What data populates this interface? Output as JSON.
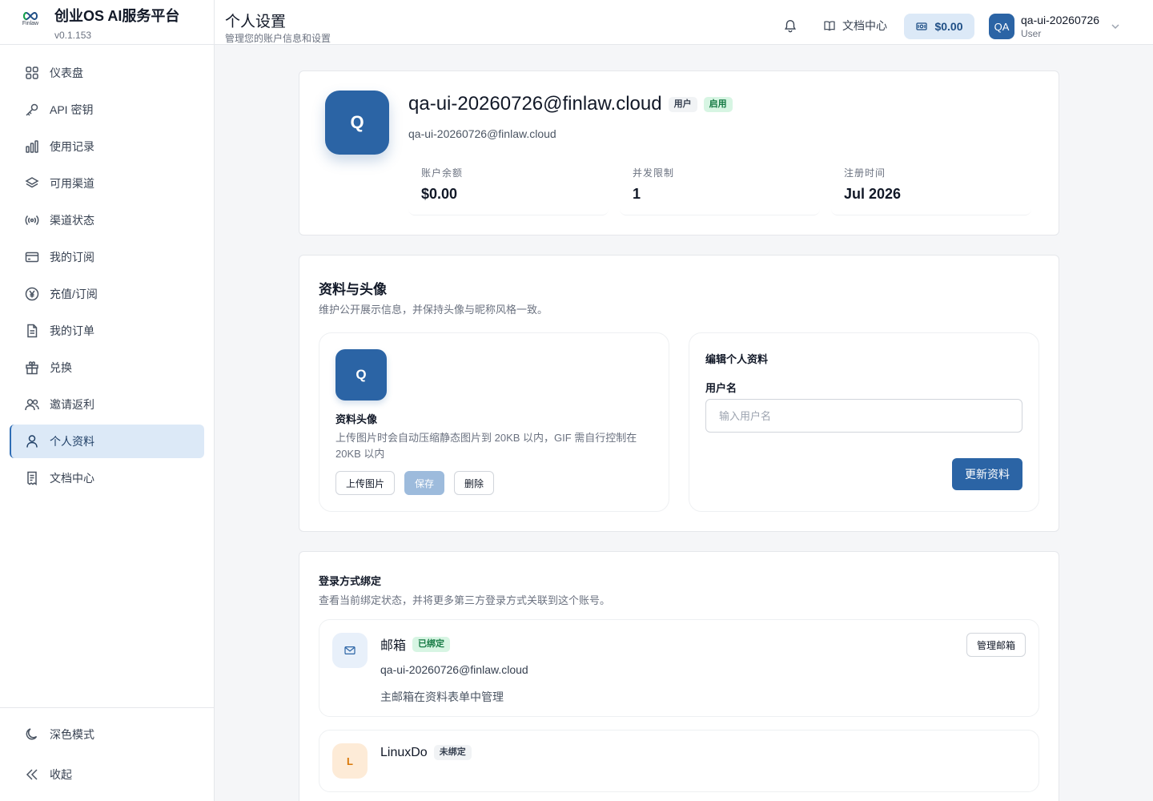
{
  "brand": {
    "title": "创业OS AI服务平台",
    "version": "v0.1.153",
    "logo_text": "Finlaw"
  },
  "sidebar": {
    "items": [
      {
        "label": "仪表盘",
        "icon": "dashboard-icon"
      },
      {
        "label": "API 密钥",
        "icon": "key-icon"
      },
      {
        "label": "使用记录",
        "icon": "bar-chart-icon"
      },
      {
        "label": "可用渠道",
        "icon": "layers-icon"
      },
      {
        "label": "渠道状态",
        "icon": "signal-icon"
      },
      {
        "label": "我的订阅",
        "icon": "credit-card-icon"
      },
      {
        "label": "充值/订阅",
        "icon": "yen-coin-icon"
      },
      {
        "label": "我的订单",
        "icon": "document-icon"
      },
      {
        "label": "兑换",
        "icon": "gift-icon"
      },
      {
        "label": "邀请返利",
        "icon": "users-icon"
      },
      {
        "label": "个人资料",
        "icon": "user-icon",
        "active": true
      },
      {
        "label": "文档中心",
        "icon": "receipt-icon"
      }
    ],
    "bottom": [
      {
        "label": "深色模式",
        "icon": "moon-icon"
      },
      {
        "label": "收起",
        "icon": "double-chevron-left-icon"
      }
    ]
  },
  "header": {
    "title": "个人设置",
    "subtitle": "管理您的账户信息和设置",
    "docs_label": "文档中心",
    "balance": "$0.00",
    "user_initials": "QA",
    "user_name": "qa-ui-20260726",
    "user_role": "User"
  },
  "profile": {
    "initial": "Q",
    "name": "qa-ui-20260726@finlaw.cloud",
    "role_tag": "用户",
    "status_tag": "启用",
    "email": "qa-ui-20260726@finlaw.cloud",
    "stats": [
      {
        "label": "账户余额",
        "value": "$0.00"
      },
      {
        "label": "并发限制",
        "value": "1"
      },
      {
        "label": "注册时间",
        "value": "Jul 2026"
      }
    ]
  },
  "profile_section": {
    "title": "资料与头像",
    "description": "维护公开展示信息，并保持头像与昵称风格一致。",
    "avatar_initial": "Q",
    "avatar_label": "资料头像",
    "avatar_hint": "上传图片时会自动压缩静态图片到 20KB 以内，GIF 需自行控制在 20KB 以内",
    "upload_label": "上传图片",
    "save_label": "保存",
    "delete_label": "删除",
    "edit_title": "编辑个人资料",
    "username_label": "用户名",
    "username_placeholder": "输入用户名",
    "username_value": "",
    "update_label": "更新资料"
  },
  "bindings": {
    "title": "登录方式绑定",
    "description": "查看当前绑定状态，并将更多第三方登录方式关联到这个账号。",
    "email": {
      "name": "邮箱",
      "status": "已绑定",
      "value": "qa-ui-20260726@finlaw.cloud",
      "note": "主邮箱在资料表单中管理",
      "manage_label": "管理邮箱"
    },
    "linuxdo": {
      "initial": "L",
      "name": "LinuxDo",
      "status": "未绑定"
    }
  },
  "colors": {
    "accent": "#2b64a5",
    "active_bg": "#dce9f7",
    "success_bg": "#d7f5e3",
    "success_text": "#167a44"
  }
}
